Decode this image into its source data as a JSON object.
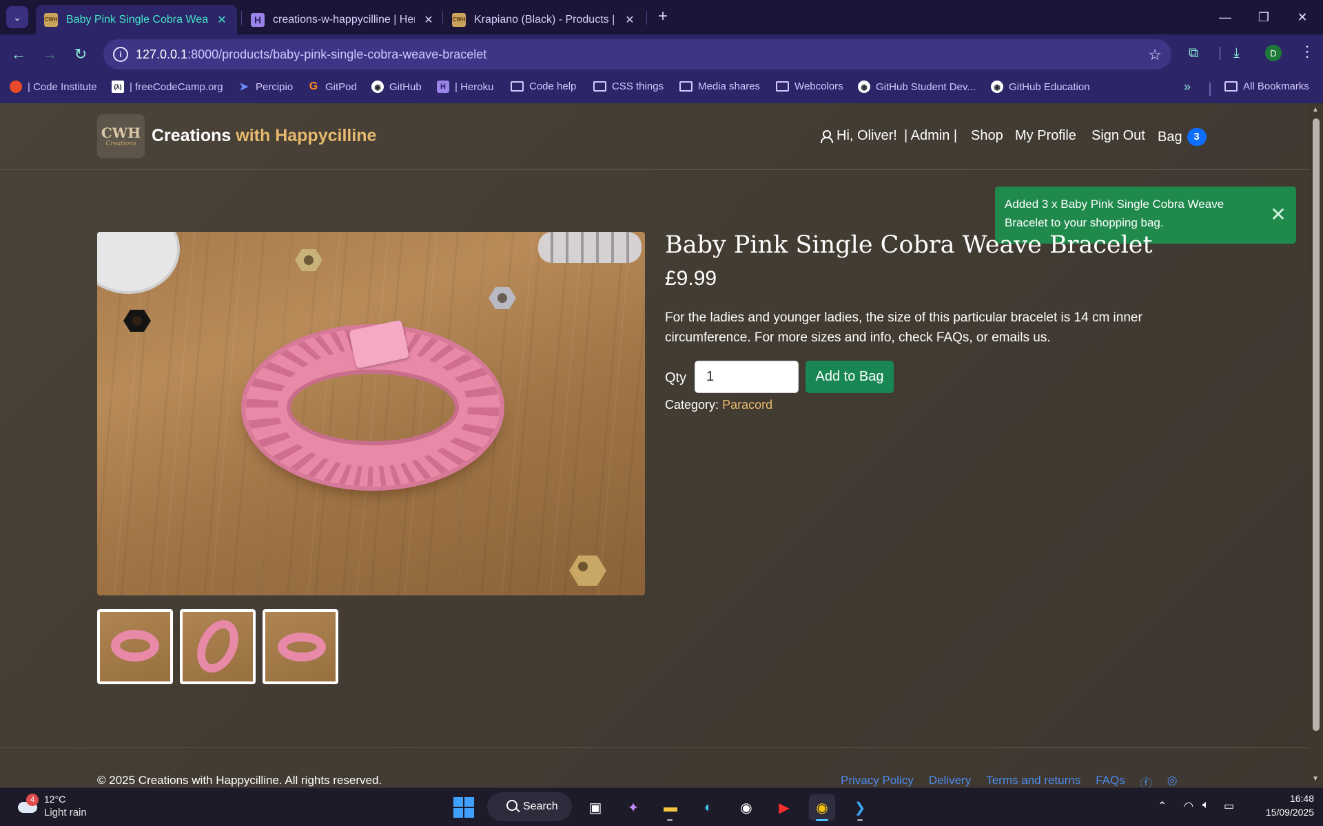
{
  "browser": {
    "tabs": [
      {
        "title": "Baby Pink Single Cobra Weave Bracelet",
        "favicon": "CWH",
        "active": true
      },
      {
        "title": "creations-w-happycilline | Heroku",
        "favicon": "H",
        "active": false
      },
      {
        "title": "Krapiano (Black) - Products | Creations",
        "favicon": "CWH",
        "active": false
      }
    ],
    "url_host": "127.0.0.1",
    "url_rest": ":8000/products/baby-pink-single-cobra-weave-bracelet",
    "profile_initial": "D",
    "bookmarks": [
      {
        "label": "| Code Institute",
        "icon": "code-institute-icon"
      },
      {
        "label": "| freeCodeCamp.org",
        "icon": "freecodecamp-icon"
      },
      {
        "label": "Percipio",
        "icon": "percipio-icon"
      },
      {
        "label": "GitPod",
        "icon": "gitpod-icon"
      },
      {
        "label": "GitHub",
        "icon": "github-icon"
      },
      {
        "label": "| Heroku",
        "icon": "heroku-icon"
      },
      {
        "label": "Code help",
        "icon": "folder-icon"
      },
      {
        "label": "CSS things",
        "icon": "folder-icon"
      },
      {
        "label": "Media shares",
        "icon": "folder-icon"
      },
      {
        "label": "Webcolors",
        "icon": "folder-icon"
      },
      {
        "label": "GitHub Student Dev...",
        "icon": "github-icon"
      },
      {
        "label": "GitHub Education",
        "icon": "github-icon"
      }
    ],
    "all_bookmarks": "All Bookmarks"
  },
  "site": {
    "logo_mark": "CWH",
    "logo_sub": "Creations",
    "brand_main": "Creations",
    "brand_accent": "with Happycilline",
    "nav": {
      "greeting": "Hi, Oliver!",
      "admin": "| Admin |",
      "shop": "Shop",
      "profile": "My Profile",
      "signout": "Sign Out",
      "bag": "Bag",
      "bag_count": "3"
    },
    "toast": "Added 3 x Baby Pink Single Cobra Weave Bracelet to your shopping bag.",
    "product": {
      "title": "Baby Pink Single Cobra Weave Bracelet",
      "price": "£9.99",
      "description": "For the ladies and younger ladies, the size of this particular bracelet is 14 cm inner circumference. For more sizes and info, check FAQs, or emails us.",
      "qty_label": "Qty",
      "qty_value": "1",
      "add_button": "Add to Bag",
      "category_label": "Category:",
      "category_value": "Paracord"
    },
    "footer": {
      "copyright": "© 2025 Creations with Happycilline. All rights reserved.",
      "links": [
        "Privacy Policy",
        "Delivery",
        "Terms and returns",
        "FAQs"
      ]
    }
  },
  "taskbar": {
    "weather_temp": "12°C",
    "weather_desc": "Light rain",
    "weather_alerts": "4",
    "search_label": "Search",
    "time": "16:48",
    "date": "15/09/2025"
  },
  "colors": {
    "accent_gold": "#e6b96e",
    "success_green": "#198754",
    "bag_badge_blue": "#0d6efd",
    "page_bg": "#463f35"
  }
}
